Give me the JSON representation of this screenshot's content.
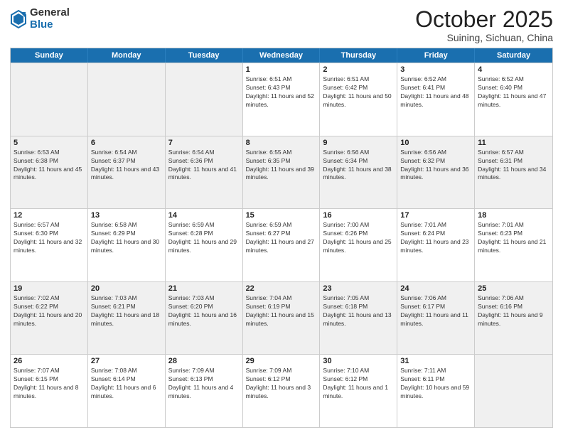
{
  "logo": {
    "general": "General",
    "blue": "Blue"
  },
  "header": {
    "month": "October 2025",
    "location": "Suining, Sichuan, China"
  },
  "weekdays": [
    "Sunday",
    "Monday",
    "Tuesday",
    "Wednesday",
    "Thursday",
    "Friday",
    "Saturday"
  ],
  "rows": [
    [
      {
        "day": "",
        "empty": true
      },
      {
        "day": "",
        "empty": true
      },
      {
        "day": "",
        "empty": true
      },
      {
        "day": "1",
        "sunrise": "Sunrise: 6:51 AM",
        "sunset": "Sunset: 6:43 PM",
        "daylight": "Daylight: 11 hours and 52 minutes."
      },
      {
        "day": "2",
        "sunrise": "Sunrise: 6:51 AM",
        "sunset": "Sunset: 6:42 PM",
        "daylight": "Daylight: 11 hours and 50 minutes."
      },
      {
        "day": "3",
        "sunrise": "Sunrise: 6:52 AM",
        "sunset": "Sunset: 6:41 PM",
        "daylight": "Daylight: 11 hours and 48 minutes."
      },
      {
        "day": "4",
        "sunrise": "Sunrise: 6:52 AM",
        "sunset": "Sunset: 6:40 PM",
        "daylight": "Daylight: 11 hours and 47 minutes."
      }
    ],
    [
      {
        "day": "5",
        "sunrise": "Sunrise: 6:53 AM",
        "sunset": "Sunset: 6:38 PM",
        "daylight": "Daylight: 11 hours and 45 minutes."
      },
      {
        "day": "6",
        "sunrise": "Sunrise: 6:54 AM",
        "sunset": "Sunset: 6:37 PM",
        "daylight": "Daylight: 11 hours and 43 minutes."
      },
      {
        "day": "7",
        "sunrise": "Sunrise: 6:54 AM",
        "sunset": "Sunset: 6:36 PM",
        "daylight": "Daylight: 11 hours and 41 minutes."
      },
      {
        "day": "8",
        "sunrise": "Sunrise: 6:55 AM",
        "sunset": "Sunset: 6:35 PM",
        "daylight": "Daylight: 11 hours and 39 minutes."
      },
      {
        "day": "9",
        "sunrise": "Sunrise: 6:56 AM",
        "sunset": "Sunset: 6:34 PM",
        "daylight": "Daylight: 11 hours and 38 minutes."
      },
      {
        "day": "10",
        "sunrise": "Sunrise: 6:56 AM",
        "sunset": "Sunset: 6:32 PM",
        "daylight": "Daylight: 11 hours and 36 minutes."
      },
      {
        "day": "11",
        "sunrise": "Sunrise: 6:57 AM",
        "sunset": "Sunset: 6:31 PM",
        "daylight": "Daylight: 11 hours and 34 minutes."
      }
    ],
    [
      {
        "day": "12",
        "sunrise": "Sunrise: 6:57 AM",
        "sunset": "Sunset: 6:30 PM",
        "daylight": "Daylight: 11 hours and 32 minutes."
      },
      {
        "day": "13",
        "sunrise": "Sunrise: 6:58 AM",
        "sunset": "Sunset: 6:29 PM",
        "daylight": "Daylight: 11 hours and 30 minutes."
      },
      {
        "day": "14",
        "sunrise": "Sunrise: 6:59 AM",
        "sunset": "Sunset: 6:28 PM",
        "daylight": "Daylight: 11 hours and 29 minutes."
      },
      {
        "day": "15",
        "sunrise": "Sunrise: 6:59 AM",
        "sunset": "Sunset: 6:27 PM",
        "daylight": "Daylight: 11 hours and 27 minutes."
      },
      {
        "day": "16",
        "sunrise": "Sunrise: 7:00 AM",
        "sunset": "Sunset: 6:26 PM",
        "daylight": "Daylight: 11 hours and 25 minutes."
      },
      {
        "day": "17",
        "sunrise": "Sunrise: 7:01 AM",
        "sunset": "Sunset: 6:24 PM",
        "daylight": "Daylight: 11 hours and 23 minutes."
      },
      {
        "day": "18",
        "sunrise": "Sunrise: 7:01 AM",
        "sunset": "Sunset: 6:23 PM",
        "daylight": "Daylight: 11 hours and 21 minutes."
      }
    ],
    [
      {
        "day": "19",
        "sunrise": "Sunrise: 7:02 AM",
        "sunset": "Sunset: 6:22 PM",
        "daylight": "Daylight: 11 hours and 20 minutes."
      },
      {
        "day": "20",
        "sunrise": "Sunrise: 7:03 AM",
        "sunset": "Sunset: 6:21 PM",
        "daylight": "Daylight: 11 hours and 18 minutes."
      },
      {
        "day": "21",
        "sunrise": "Sunrise: 7:03 AM",
        "sunset": "Sunset: 6:20 PM",
        "daylight": "Daylight: 11 hours and 16 minutes."
      },
      {
        "day": "22",
        "sunrise": "Sunrise: 7:04 AM",
        "sunset": "Sunset: 6:19 PM",
        "daylight": "Daylight: 11 hours and 15 minutes."
      },
      {
        "day": "23",
        "sunrise": "Sunrise: 7:05 AM",
        "sunset": "Sunset: 6:18 PM",
        "daylight": "Daylight: 11 hours and 13 minutes."
      },
      {
        "day": "24",
        "sunrise": "Sunrise: 7:06 AM",
        "sunset": "Sunset: 6:17 PM",
        "daylight": "Daylight: 11 hours and 11 minutes."
      },
      {
        "day": "25",
        "sunrise": "Sunrise: 7:06 AM",
        "sunset": "Sunset: 6:16 PM",
        "daylight": "Daylight: 11 hours and 9 minutes."
      }
    ],
    [
      {
        "day": "26",
        "sunrise": "Sunrise: 7:07 AM",
        "sunset": "Sunset: 6:15 PM",
        "daylight": "Daylight: 11 hours and 8 minutes."
      },
      {
        "day": "27",
        "sunrise": "Sunrise: 7:08 AM",
        "sunset": "Sunset: 6:14 PM",
        "daylight": "Daylight: 11 hours and 6 minutes."
      },
      {
        "day": "28",
        "sunrise": "Sunrise: 7:09 AM",
        "sunset": "Sunset: 6:13 PM",
        "daylight": "Daylight: 11 hours and 4 minutes."
      },
      {
        "day": "29",
        "sunrise": "Sunrise: 7:09 AM",
        "sunset": "Sunset: 6:12 PM",
        "daylight": "Daylight: 11 hours and 3 minutes."
      },
      {
        "day": "30",
        "sunrise": "Sunrise: 7:10 AM",
        "sunset": "Sunset: 6:12 PM",
        "daylight": "Daylight: 11 hours and 1 minute."
      },
      {
        "day": "31",
        "sunrise": "Sunrise: 7:11 AM",
        "sunset": "Sunset: 6:11 PM",
        "daylight": "Daylight: 10 hours and 59 minutes."
      },
      {
        "day": "",
        "empty": true
      }
    ]
  ]
}
